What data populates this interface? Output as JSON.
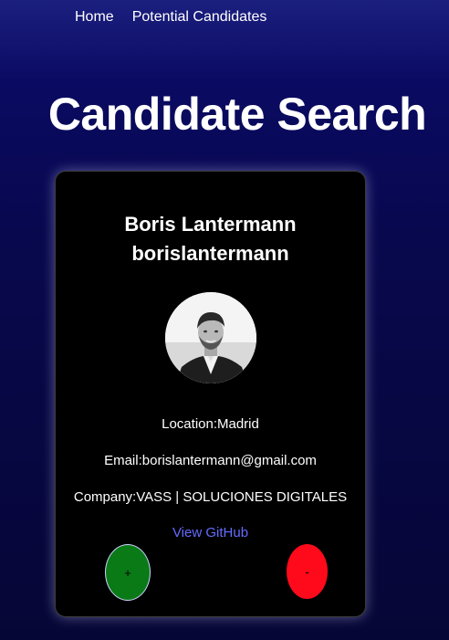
{
  "nav": {
    "items": [
      {
        "label": "Home"
      },
      {
        "label": "Potential Candidates"
      }
    ]
  },
  "page_title": "Candidate Search",
  "candidate": {
    "name": "Boris Lantermann",
    "username": "borislantermann",
    "avatar_alt": "avatar",
    "location": "Location:Madrid",
    "email": "Email:borislantermann@gmail.com",
    "company": "Company:VASS | SOLUCIONES DIGITALES",
    "github_link": "View GitHub"
  },
  "actions": {
    "add_label": "+",
    "reject_label": "-"
  },
  "colors": {
    "link": "#646cff",
    "add_button": "#0a7a17",
    "reject_button": "#ff0a1a"
  }
}
